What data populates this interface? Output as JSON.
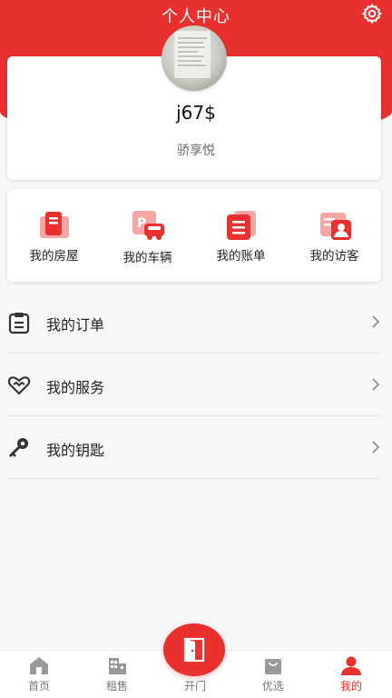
{
  "header": {
    "title": "个人中心",
    "icon": "gear-icon"
  },
  "profile": {
    "username": "j67$",
    "community": "骄享悦",
    "avatar_icon": "avatar-photo"
  },
  "quick_actions": [
    {
      "label": "我的房屋",
      "icon": "house-icon"
    },
    {
      "label": "我的车辆",
      "icon": "car-parking-icon"
    },
    {
      "label": "我的账单",
      "icon": "bill-icon"
    },
    {
      "label": "我的访客",
      "icon": "visitor-icon"
    }
  ],
  "menu": [
    {
      "label": "我的订单",
      "icon": "clipboard-icon"
    },
    {
      "label": "我的服务",
      "icon": "heart-handshake-icon"
    },
    {
      "label": "我的钥匙",
      "icon": "key-icon"
    }
  ],
  "tabbar": {
    "items": [
      {
        "label": "首页",
        "icon": "home-icon"
      },
      {
        "label": "租售",
        "icon": "building-icon"
      },
      {
        "label": "开门",
        "icon": "door-icon"
      },
      {
        "label": "优选",
        "icon": "shopping-bag-icon"
      },
      {
        "label": "我的",
        "icon": "user-icon"
      }
    ],
    "active": "我的"
  },
  "colors": {
    "accent": "#e8312f",
    "background": "#f7f7f7",
    "card": "#ffffff",
    "icon_light": "#f6a5a3"
  }
}
